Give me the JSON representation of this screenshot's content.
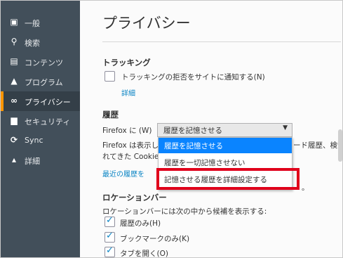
{
  "sidebar": {
    "items": [
      {
        "icon": "general-icon",
        "glyph": "▣",
        "label": "一般"
      },
      {
        "icon": "search-icon",
        "glyph": "⚲",
        "label": "検索"
      },
      {
        "icon": "content-icon",
        "glyph": "▤",
        "label": "コンテンツ"
      },
      {
        "icon": "rocket-icon",
        "glyph": "▲",
        "label": "プログラム"
      },
      {
        "icon": "mask-icon",
        "glyph": "∞",
        "label": "プライバシー"
      },
      {
        "icon": "lock-icon",
        "glyph": "▆",
        "label": "セキュリティ"
      },
      {
        "icon": "sync-icon",
        "glyph": "⟳",
        "label": "Sync"
      },
      {
        "icon": "wizard-icon",
        "glyph": "▴",
        "label": "詳細"
      }
    ],
    "active_index": 4
  },
  "main": {
    "title": "プライバシー",
    "tracking": {
      "heading": "トラッキング",
      "dnt_label": "トラッキングの拒否をサイトに通知する(N)",
      "details_link": "詳細"
    },
    "history": {
      "heading": "履歴",
      "firefox_label": "Firefox に (W)",
      "select_value": "履歴を記憶させる",
      "desc1_left": "Firefox は表示し",
      "desc1_right": "ード履歴、検索や",
      "desc2_left": "れてきた Cookie",
      "recent_link": "最近の履歴を",
      "trailing": "。",
      "dropdown": [
        "履歴を記憶させる",
        "履歴を一切記憶させない",
        "記憶させる履歴を詳細設定する"
      ]
    },
    "location_bar": {
      "heading": "ロケーションバー",
      "desc": "ロケーションバーには次の中から候補を表示する:",
      "options": [
        {
          "label": "履歴のみ(H)",
          "checked": true
        },
        {
          "label": "ブックマークのみ(K)",
          "checked": true
        },
        {
          "label": "タブを開く(O)",
          "checked": true
        }
      ]
    }
  },
  "colors": {
    "accent": "#0a84ff",
    "sidebar_bg": "#424f5a",
    "highlight": "#e0001b",
    "active_marker": "#ff9500"
  }
}
